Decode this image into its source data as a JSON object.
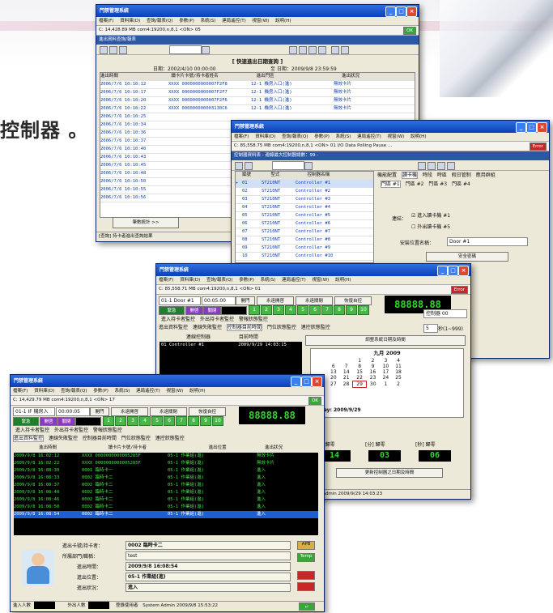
{
  "page": {
    "tagline": "控制器 。"
  },
  "colors": {
    "title_bar": "#0a40b8",
    "accent_green": "#3aa63a",
    "monitor_bg": "#000000",
    "alert_red": "#c62828"
  },
  "win1": {
    "title": "門禁管理系統",
    "menu": [
      "檔案(F)",
      "資料庫(D)",
      "查詢/報表(Q)",
      "參數(P)",
      "系統(S)",
      "連局遙控(T)",
      "視窗(W)",
      "說明(H)"
    ],
    "address": "C: 14,428.89 MB   com4:19200,n,8,1 <ON> 05",
    "ok": "OK",
    "subtitle": "進出資料查詢/報表",
    "caption": "[ 快速進出日期查詢 ]",
    "date_from": "日期：2002/4/10 00:00:00",
    "date_to": "至 日期：2009/9/8 23:59:59",
    "columns": [
      "進出時間",
      "讀卡片卡號/持卡者姓名",
      "進出門區",
      "進出狀況"
    ],
    "rows": [
      {
        "time": "2006/7/6 10:10:12",
        "card": "XXXX 0000000000007F2F8",
        "door": "12-1 機房入口(進)",
        "state": "無效卡片"
      },
      {
        "time": "2006/7/6 10:10:17",
        "card": "XXXX 0000000000007F2F7",
        "door": "12-1 機房入口(進)",
        "state": "無效卡片"
      },
      {
        "time": "2006/7/6 10:10:20",
        "card": "XXXX 0000000000007F2F6",
        "door": "12-1 機房入口(進)",
        "state": "無效卡片"
      },
      {
        "time": "2006/7/6 10:10:22",
        "card": "XXXX 000000000003130C6",
        "door": "12-1 機房入口(進)",
        "state": "無效卡片"
      },
      {
        "time": "2006/7/6 10:10:25",
        "card": "",
        "door": "",
        "state": ""
      },
      {
        "time": "2006/7/6 10:10:34",
        "card": "",
        "door": "",
        "state": ""
      },
      {
        "time": "2006/7/6 10:10:36",
        "card": "",
        "door": "",
        "state": ""
      },
      {
        "time": "2006/7/6 10:10:37",
        "card": "",
        "door": "",
        "state": ""
      },
      {
        "time": "2006/7/6 10:10:40",
        "card": "",
        "door": "",
        "state": ""
      },
      {
        "time": "2006/7/6 10:10:43",
        "card": "",
        "door": "",
        "state": ""
      },
      {
        "time": "2006/7/6 10:10:45",
        "card": "",
        "door": "",
        "state": ""
      },
      {
        "time": "2006/7/6 10:10:48",
        "card": "",
        "door": "",
        "state": ""
      },
      {
        "time": "2006/7/6 10:10:50",
        "card": "",
        "door": "",
        "state": ""
      },
      {
        "time": "2006/7/6 10:10:55",
        "card": "",
        "door": "",
        "state": ""
      },
      {
        "time": "2006/7/6 10:10:56",
        "card": "",
        "door": "",
        "state": ""
      }
    ],
    "stats_button": "筆數統計 >>",
    "footer": "[查詢] 持卡者進出查詢結果"
  },
  "win2": {
    "title": "門禁管理系統",
    "menu": [
      "檔案(F)",
      "資料庫(D)",
      "查詢/報表(Q)",
      "參數(P)",
      "系統(S)",
      "連局遙控(T)",
      "視窗(W)",
      "說明(H)"
    ],
    "address": "C: 85,558.75 MB   com4:19200,n,8,1 <ON>  01  I/O Data Polling Pause ...",
    "error": "Error",
    "subtitle": "控制器資料表 - 連線最大控制器總數：99 -",
    "columns": [
      "編號",
      "型式",
      "控制器名稱"
    ],
    "rows": [
      {
        "no": "01",
        "type": "ST210NT",
        "name": "Controller #1"
      },
      {
        "no": "02",
        "type": "ST210NT",
        "name": "Controller #2"
      },
      {
        "no": "03",
        "type": "ST210NT",
        "name": "Controller #3"
      },
      {
        "no": "04",
        "type": "ST210NT",
        "name": "Controller #4"
      },
      {
        "no": "05",
        "type": "ST210NT",
        "name": "Controller #5"
      },
      {
        "no": "06",
        "type": "ST210NT",
        "name": "Controller #6"
      },
      {
        "no": "07",
        "type": "ST210NT",
        "name": "Controller #7"
      },
      {
        "no": "08",
        "type": "ST210NT",
        "name": "Controller #8"
      },
      {
        "no": "09",
        "type": "ST210NT",
        "name": "Controller #9"
      },
      {
        "no": "10",
        "type": "ST210NT",
        "name": "Controller #10"
      }
    ],
    "tabs": [
      "機能配置",
      "讀卡機",
      "時段",
      "時區",
      "假日管制",
      "應用群組"
    ],
    "door_tabs": [
      "門區 #1",
      "門區 #2",
      "門區 #3",
      "門區 #4"
    ],
    "reader_label": "連結：",
    "in_reader": "進入讀卡機 #1",
    "out_reader": "外出讀卡機 #5",
    "door_name_label": "安裝位置名稱：",
    "door_name_value": "Door #1",
    "security_label": "安全密碼"
  },
  "win3": {
    "title": "門禁管理系統",
    "menu": [
      "檔案(F)",
      "資料庫(D)",
      "查詢/報表(Q)",
      "參數(P)",
      "系統(S)",
      "連局遙控(T)",
      "視窗(W)",
      "說明(H)"
    ],
    "address": "C: 85,558.71 MB   com4:19200,n,8,1 <ON>  01",
    "error": "Error",
    "door_select": "01-1 Door #1",
    "time_value": "00:05:00",
    "buttons": [
      "開門",
      "永遠開啓",
      "永遠關閉",
      "恢復自控"
    ],
    "alarm": "緊急",
    "open": "開啓",
    "close": "關閉",
    "numbers": [
      "1",
      "2",
      "3",
      "4",
      "5",
      "6",
      "7",
      "8",
      "9",
      "10"
    ],
    "display": "88888.88",
    "tabs1": [
      "進入持卡者監控",
      "外出持卡者監控",
      "警報狀態監控"
    ],
    "tabs2": [
      "進出資料監控",
      "連線失敗監控",
      "控制器目前時間",
      "門位狀態監控",
      "連控狀態監控"
    ],
    "col1": "連線控制器",
    "col2": "目前時間",
    "monitor_row": {
      "name": "01 Controller #1",
      "time": "2009/9/29   14:03:15"
    },
    "adjust_button": "調整系統日期及時間",
    "calendar_title": "九月 2009",
    "calendar_rows": [
      [
        "",
        "",
        "1",
        "2",
        "3",
        "4",
        ""
      ],
      [
        "6",
        "7",
        "8",
        "9",
        "10",
        "11",
        ""
      ],
      [
        "13",
        "14",
        "15",
        "16",
        "17",
        "18",
        ""
      ],
      [
        "20",
        "21",
        "22",
        "23",
        "24",
        "25",
        ""
      ],
      [
        "27",
        "28",
        "29",
        "30",
        "1",
        "2",
        ""
      ]
    ],
    "today_label": "Today: 2009/9/29",
    "right_select": "控制器 00",
    "sec_value": "5",
    "sec_label": "秒(1~999)",
    "hour_label": "[時] 歸零",
    "min_label": "[分] 歸零",
    "sec_reset_label": "[秒] 歸零",
    "hour_val": "14",
    "min_val": "03",
    "sec_val": "06",
    "update_button": "更新控制器之日期及時間",
    "status": "System Admin  2009/9/29  14:03:23"
  },
  "win4": {
    "title": "門禁管理系統",
    "menu": [
      "檔案(F)",
      "資料庫(D)",
      "查詢/報表(Q)",
      "參數(P)",
      "系統(S)",
      "連局遙控(T)",
      "視窗(W)",
      "說明(H)"
    ],
    "address": "C: 14,429.79 MB   com4:19200,n,8,1 <ON>  17",
    "ok": "OK",
    "door_select": "01-1 IF 機房入",
    "time_value": "00:00:05",
    "buttons": [
      "開門",
      "永遠開啓",
      "永遠關閉",
      "恢復自控"
    ],
    "alarm": "緊急",
    "open": "開啓",
    "close": "關閉",
    "numbers": [
      "1",
      "2",
      "3",
      "4",
      "5",
      "6",
      "7",
      "8",
      "9",
      "10"
    ],
    "display": "88888.88",
    "tabs1": [
      "進入持卡者監控",
      "外出持卡者監控",
      "警報狀態監控"
    ],
    "tabs2": [
      "進出資料監控",
      "連線失敗監控",
      "控制器目前時間",
      "門位狀態監控",
      "連控狀態監控"
    ],
    "columns": [
      "進出時間",
      "讀卡片卡號/持卡者",
      "進出位置",
      "進出狀況"
    ],
    "rows": [
      {
        "time": "2009/9/8   16:02:12",
        "card": "XXXX 0000000000005285F",
        "door": "05-1 作業組(進)",
        "state": "無效卡片"
      },
      {
        "time": "2009/9/8   16:02:22",
        "card": "XXXX 0000000000005285F",
        "door": "05-1 作業組(進)",
        "state": "無效卡片"
      },
      {
        "time": "2009/9/8   16:08:30",
        "card": "0001 臨時卡一",
        "door": "05-1 作業組(進)",
        "state": "進入"
      },
      {
        "time": "2009/9/8   16:08:33",
        "card": "0002 臨時卡二",
        "door": "05-1 作業組(進)",
        "state": "進入"
      },
      {
        "time": "2009/9/8   16:08:37",
        "card": "0002 臨時卡二",
        "door": "05-1 作業組(進)",
        "state": "進入"
      },
      {
        "time": "2009/9/8   16:08:40",
        "card": "0002 臨時卡二",
        "door": "05-1 作業組(進)",
        "state": "進入"
      },
      {
        "time": "2009/9/8   16:08:46",
        "card": "0002 臨時卡二",
        "door": "05-1 作業組(進)",
        "state": "進入"
      },
      {
        "time": "2009/9/8   16:08:50",
        "card": "0002 臨時卡二",
        "door": "05-1 作業組(進)",
        "state": "進入"
      },
      {
        "time": "2009/9/8   16:08:54",
        "card": "0002 臨時卡二",
        "door": "05-1 作業組(進)",
        "state": "進入"
      }
    ],
    "detail": {
      "card_label": "進出卡號/持卡者：",
      "card_value": "0002 臨時卡二",
      "dept_label": "所屬部門/職稱：",
      "dept_value": "test",
      "time_label": "進出時間：",
      "time_value": "2009/9/8 16:08:54",
      "pos_label": "進出位置：",
      "pos_value": "05-1 作業組(進)",
      "state_label": "進出狀況：",
      "state_value": "進入"
    },
    "side_buttons": [
      "APB",
      "Temp",
      "",
      ""
    ],
    "status": {
      "in_label": "進入人數",
      "out_label": "外出人數",
      "login_label": "登錄使用者",
      "user": "System Admin  2009/9/8  15:53:22"
    }
  }
}
